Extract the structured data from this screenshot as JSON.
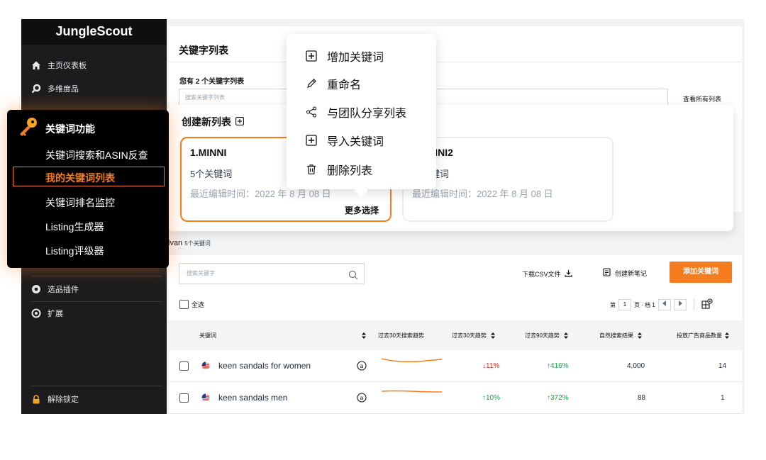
{
  "brand": "JungleScout",
  "sidebar": {
    "items": [
      {
        "label": "主页仪表板",
        "icon": "home-icon"
      },
      {
        "label": "多维度品",
        "icon": "search-icon"
      }
    ],
    "extra_items": [
      {
        "label": "选品插件",
        "icon": "plugin-icon"
      },
      {
        "label": "扩展",
        "icon": "extension-icon"
      }
    ],
    "unlock": "解除锁定"
  },
  "main": {
    "title": "关键字列表",
    "you_have": "您有 2 个关键字列表",
    "search_placeholder": "搜索关键字列表",
    "view_all": "查看所有列表",
    "list_name": "lvan",
    "list_count": "5个关键词"
  },
  "cards_panel": {
    "new_list": "创建新列表",
    "cards": [
      {
        "name": "1.MINNI",
        "count": "5个关键词",
        "edited": "最近编辑时间：2022 年 8 月 08 日",
        "more": "更多选择"
      },
      {
        "name": "NNI2",
        "count": "键词",
        "edited": "最近编辑时间：2022 年 8 月 08 日"
      }
    ]
  },
  "context_menu": {
    "items": [
      {
        "label": "增加关键词",
        "icon": "plus-square-icon"
      },
      {
        "label": "重命名",
        "icon": "pencil-icon"
      },
      {
        "label": "与团队分享列表",
        "icon": "share-icon"
      },
      {
        "label": "导入关键词",
        "icon": "plus-square-icon"
      },
      {
        "label": "删除列表",
        "icon": "trash-icon"
      }
    ]
  },
  "keyword_feature": {
    "title": "关键词功能",
    "items": [
      "关键词搜索和ASIN反查",
      "我的关键词列表",
      "关键词排名监控",
      "Listing生成器",
      "Listing评级器"
    ],
    "active_index": 1
  },
  "toolbar": {
    "search_placeholder": "搜索关键字",
    "csv": "下载CSV文件",
    "note": "创建新笔记",
    "add": "添加关键词",
    "select_all": "全选",
    "page_label": "第",
    "page_num": "1",
    "page_of": "页 · 档 1"
  },
  "table": {
    "headers": [
      "关键词",
      "过去30天搜索趋势",
      "过去30天趋势",
      "过去90天趋势",
      "自然搜索结果",
      "投放广告商品数量"
    ],
    "rows": [
      {
        "keyword": "keen sandals for women",
        "trend30": "↓11%",
        "trend30_dir": "down",
        "trend90": "↑416%",
        "organic": "4,000",
        "sponsored": "14"
      },
      {
        "keyword": "keen sandals men",
        "trend30": "↑10%",
        "trend30_dir": "up",
        "trend90": "↑372%",
        "organic": "88",
        "sponsored": "1"
      }
    ]
  },
  "colors": {
    "accent": "#f57c1f",
    "sidebar": "#1c1c1e",
    "up": "#16a34a",
    "down": "#dc2626"
  }
}
